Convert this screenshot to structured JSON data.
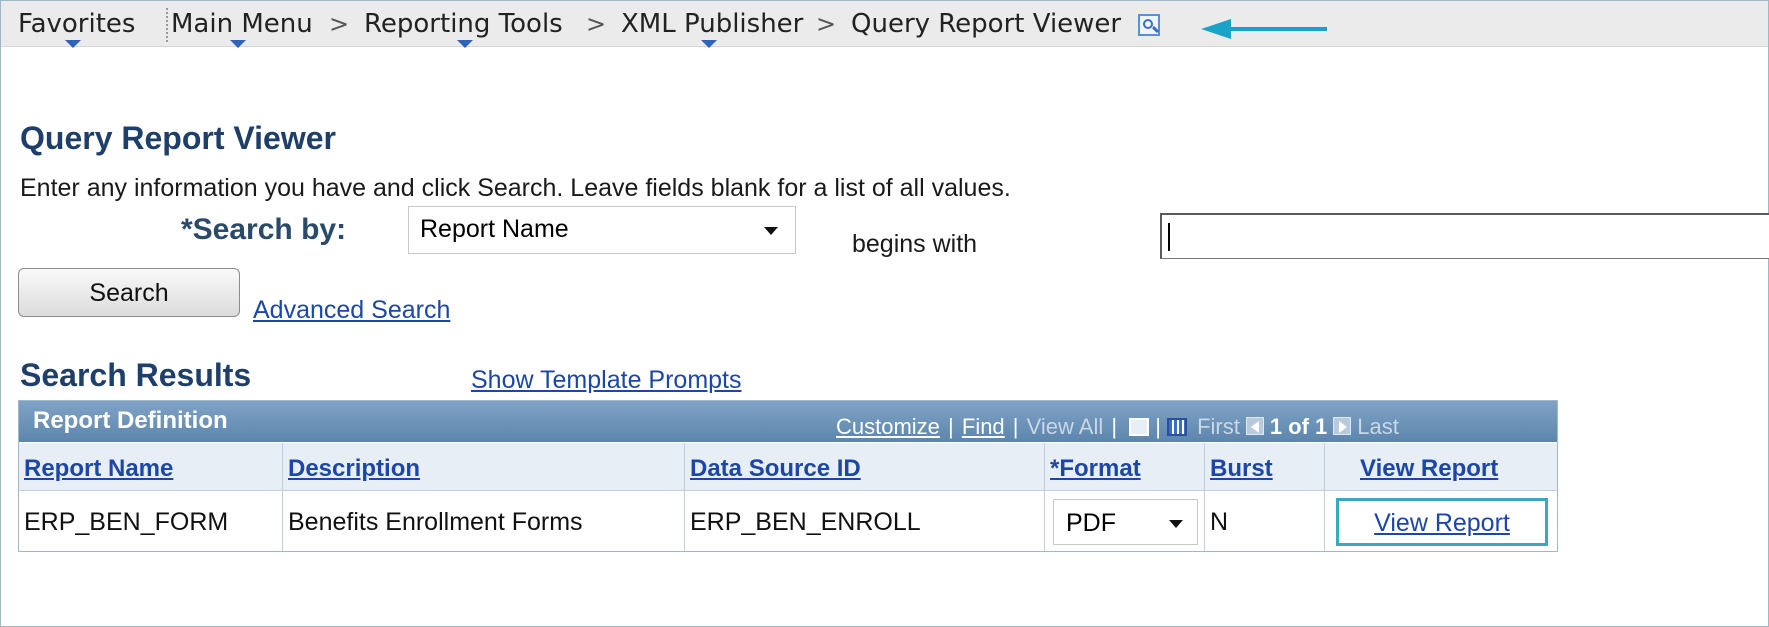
{
  "breadcrumb": {
    "favorites": "Favorites",
    "main_menu": "Main Menu",
    "separator": ">",
    "reporting_tools": "Reporting Tools",
    "xml_publisher": "XML Publisher",
    "current": "Query Report Viewer"
  },
  "page": {
    "title": "Query Report Viewer",
    "instructions": "Enter any information you have and click Search. Leave fields blank for a list of all values."
  },
  "search": {
    "search_by_label": "*Search by:",
    "search_by_value": "Report Name",
    "operator_label": "begins with",
    "input_value": "",
    "search_button": "Search",
    "advanced_search": "Advanced Search"
  },
  "results": {
    "title": "Search Results",
    "show_template_prompts": "Show Template Prompts",
    "grid_title": "Report Definition",
    "toolbar": {
      "customize": "Customize",
      "find": "Find",
      "view_all": "View All",
      "first": "First",
      "pagination": "1 of 1",
      "last": "Last"
    },
    "columns": {
      "report_name": "Report Name",
      "description": "Description",
      "data_source_id": "Data Source ID",
      "format": "*Format",
      "burst": "Burst",
      "view_report": "View Report"
    },
    "rows": [
      {
        "report_name": "ERP_BEN_FORM",
        "description": "Benefits Enrollment Forms",
        "data_source_id": "ERP_BEN_ENROLL",
        "format": "PDF",
        "burst": "N",
        "view_report": "View Report"
      }
    ]
  },
  "icons": {
    "favorites_dropdown": "chevron-down-icon",
    "new_window": "new-window-icon",
    "arrow": "arrow-left-icon",
    "download": "download-grid-icon",
    "prev": "previous-icon",
    "next": "next-icon"
  },
  "colors": {
    "accent": "#1aa3c8",
    "grid_header": "#5e86ad",
    "link": "#1c46a8",
    "title": "#1f3f6b"
  }
}
